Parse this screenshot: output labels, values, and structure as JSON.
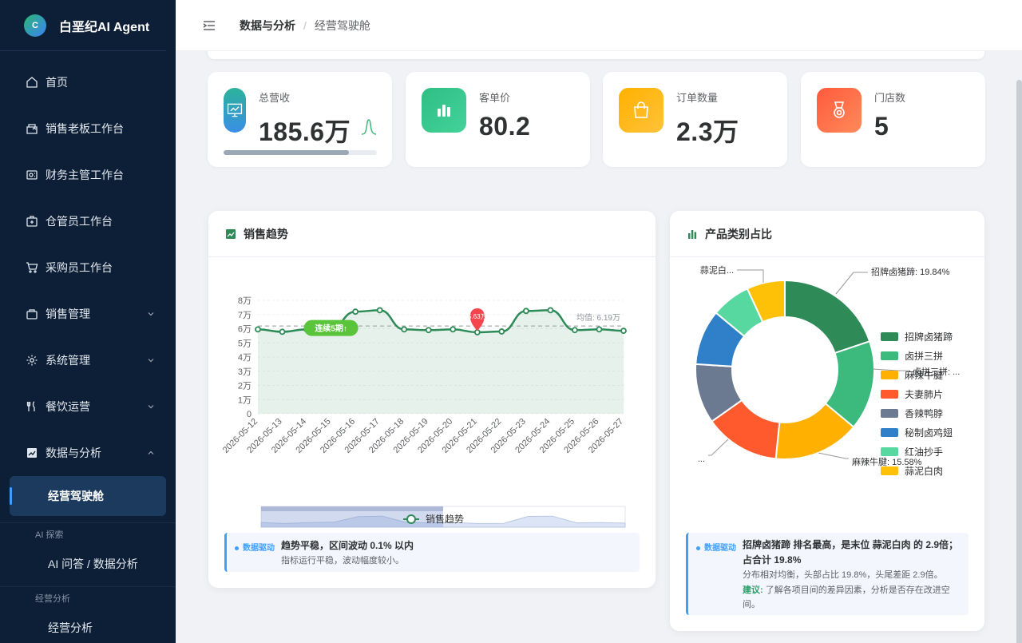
{
  "app": {
    "name": "白垩纪AI Agent",
    "logo_letter": "C"
  },
  "sidebar": {
    "items": [
      {
        "label": "首页",
        "icon": "home-icon"
      },
      {
        "label": "销售老板工作台",
        "icon": "store-icon"
      },
      {
        "label": "财务主管工作台",
        "icon": "finance-icon"
      },
      {
        "label": "仓管员工作台",
        "icon": "warehouse-icon"
      },
      {
        "label": "采购员工作台",
        "icon": "cart-icon"
      },
      {
        "label": "销售管理",
        "icon": "bag-icon"
      },
      {
        "label": "系统管理",
        "icon": "gear-icon"
      },
      {
        "label": "餐饮运营",
        "icon": "fork-knife-icon"
      },
      {
        "label": "数据与分析",
        "icon": "chart-icon"
      }
    ],
    "active_sub": "经营驾驶舱",
    "group_ai": "AI 探索",
    "ai_item": "AI 问答 / 数据分析",
    "group_biz": "经营分析",
    "biz_item": "经营分析"
  },
  "breadcrumb": {
    "parent": "数据与分析",
    "sep": "/",
    "current": "经营驾驶舱"
  },
  "stats": [
    {
      "label": "总营收",
      "value": "185.6万",
      "icon": "presentation-chart-icon",
      "progress": 0.82,
      "color_from": "#2bb39a",
      "color_to": "#3a8ee6"
    },
    {
      "label": "客单价",
      "value": "80.2",
      "icon": "bar-chart-icon",
      "color_from": "#2fbf85",
      "color_to": "#43d39a"
    },
    {
      "label": "订单数量",
      "value": "2.3万",
      "icon": "shopping-bag-icon",
      "color_from": "#ffb100",
      "color_to": "#ffc23a"
    },
    {
      "label": "门店数",
      "value": "5",
      "icon": "medal-icon",
      "color_from": "#ff5a3c",
      "color_to": "#ff8a5a"
    }
  ],
  "sales_card": {
    "title": "销售趋势",
    "legend": "销售趋势",
    "insight_tag": "数据驱动",
    "insight_main": "趋势平稳，区间波动 0.1% 以内",
    "insight_sub": "指标运行平稳，波动幅度较小。"
  },
  "pie_card": {
    "title": "产品类别占比",
    "insight_tag": "数据驱动",
    "insight_main": "招牌卤猪蹄 排名最高，是末位 蒜泥白肉 的 2.9倍；占合计 19.8%",
    "insight_sub": "分布相对均衡，头部占比 19.8%，头尾差距 2.9倍。",
    "suggest_label": "建议:",
    "suggest_text": "了解各项目间的差异因素，分析是否存在改进空间。"
  },
  "chart_data": [
    {
      "type": "line",
      "title": "销售趋势",
      "x": [
        "2026-05-12",
        "2026-05-13",
        "2026-05-14",
        "2026-05-15",
        "2026-05-16",
        "2026-05-17",
        "2026-05-18",
        "2026-05-19",
        "2026-05-20",
        "2026-05-21",
        "2026-05-22",
        "2026-05-23",
        "2026-05-24",
        "2026-05-25",
        "2026-05-26",
        "2026-05-27"
      ],
      "series": [
        {
          "name": "销售趋势",
          "values": [
            5.95,
            5.78,
            5.95,
            6.05,
            7.2,
            7.3,
            5.95,
            5.9,
            5.95,
            5.75,
            5.8,
            7.25,
            7.3,
            5.9,
            5.95,
            5.85
          ]
        }
      ],
      "ylim": [
        0,
        8
      ],
      "yticks": [
        "0",
        "1万",
        "2万",
        "3万",
        "4万",
        "5万",
        "6万",
        "7万",
        "8万"
      ],
      "mean_label": "均值: 6.19万",
      "mean_value": 6.19,
      "badge": "连续5期↑",
      "min_marker": "5.63万",
      "line_color": "#2e8b57"
    },
    {
      "type": "pie",
      "title": "产品类别占比",
      "categories": [
        "招牌卤猪蹄",
        "卤拼三拼",
        "麻辣牛腱",
        "夫妻肺片",
        "香辣鸭脖",
        "秘制卤鸡翅",
        "红油抄手",
        "蒜泥白肉"
      ],
      "values": [
        19.84,
        16.2,
        15.58,
        13.6,
        10.8,
        9.98,
        7.1,
        6.9
      ],
      "colors": [
        "#2e8b57",
        "#3cb97d",
        "#ffb000",
        "#ff5a2e",
        "#6b7a90",
        "#2f80c8",
        "#57d8a0",
        "#ffc107"
      ],
      "visible_labels": [
        "招牌卤猪蹄: 19.84%",
        "卤拼三拼: ...",
        "麻辣牛腱: 15.58%",
        "蒜泥白...",
        "..."
      ],
      "legend": "right"
    }
  ]
}
